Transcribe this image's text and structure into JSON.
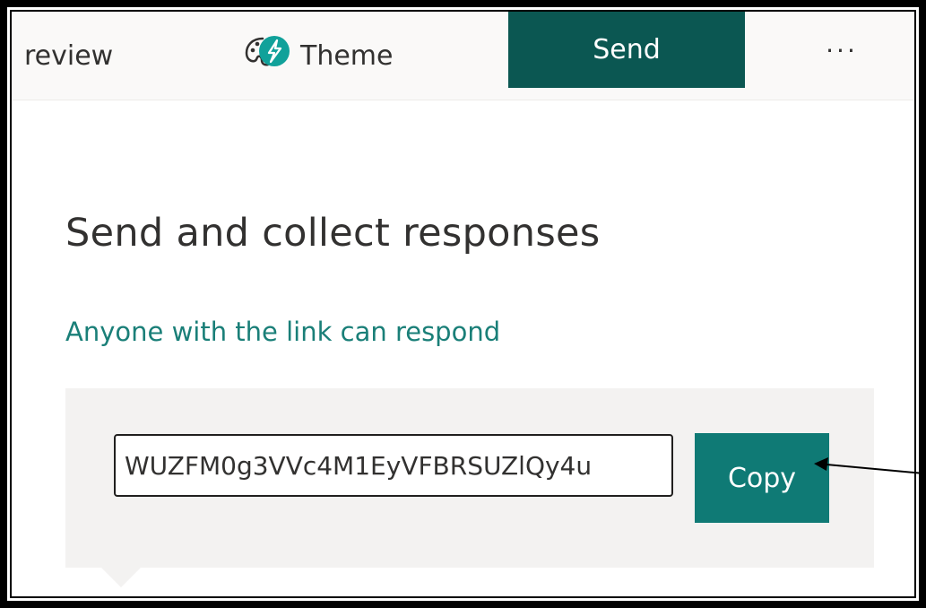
{
  "tabs": {
    "preview_label": "review",
    "theme_label": "Theme",
    "send_label": "Send",
    "more_label": "···"
  },
  "main": {
    "heading": "Send and collect responses",
    "permission_text": "Anyone with the link can respond",
    "link_value": "WUZFM0g3VVc4M1EyVFBRSUZlQy4u",
    "copy_label": "Copy"
  },
  "icons": {
    "theme": "palette-lightning-icon",
    "annotation": "arrow-left-icon"
  },
  "colors": {
    "accent_dark": "#0b5752",
    "accent": "#0f7a75",
    "link_text": "#1a7f78",
    "panel_bg": "#f3f2f1"
  }
}
